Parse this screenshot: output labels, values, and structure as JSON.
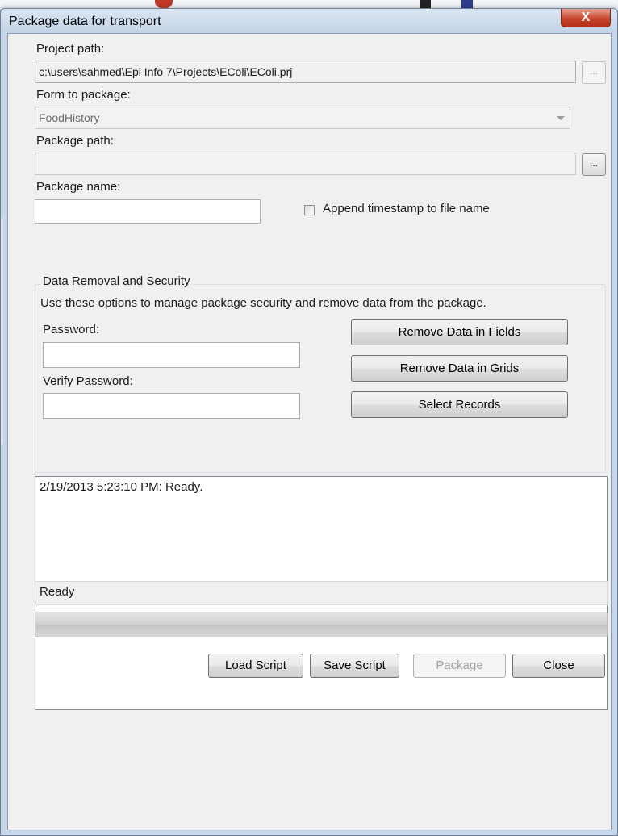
{
  "window": {
    "title": "Package data for transport",
    "close_glyph": "X"
  },
  "project": {
    "label": "Project path:",
    "value": "c:\\users\\sahmed\\Epi Info 7\\Projects\\EColi\\EColi.prj",
    "browse_label": "..."
  },
  "form": {
    "label": "Form to package:",
    "selected": "FoodHistory"
  },
  "package_path": {
    "label": "Package path:",
    "value": "",
    "browse_label": "..."
  },
  "package_name": {
    "label": "Package name:",
    "value": "",
    "append_timestamp_label": "Append timestamp to file name",
    "append_timestamp_checked": false
  },
  "security": {
    "group_title": "Data Removal and Security",
    "description": "Use these options to manage package security and remove data from the package.",
    "password_label": "Password:",
    "password_value": "",
    "verify_label": "Verify Password:",
    "verify_value": "",
    "remove_fields_label": "Remove Data in Fields",
    "remove_grids_label": "Remove Data in Grids",
    "select_records_label": "Select Records"
  },
  "log": {
    "lines": [
      "2/19/2013 5:23:10 PM: Ready."
    ]
  },
  "status": {
    "text": "Ready",
    "progress": 0
  },
  "footer": {
    "load_script": "Load Script",
    "save_script": "Save Script",
    "package": "Package",
    "close": "Close"
  },
  "colors": {
    "title_bar": "#c3d3e7",
    "close_button": "#c7442c",
    "dialog_bg": "#f0f0f0"
  }
}
